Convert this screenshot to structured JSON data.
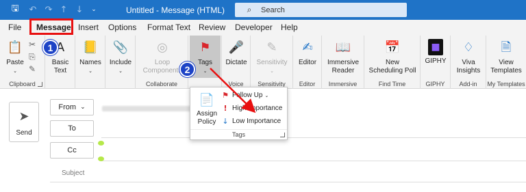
{
  "titlebar": {
    "title": "Untitled  -  Message (HTML)",
    "search_placeholder": "Search",
    "icons": [
      "save-icon",
      "undo-icon",
      "redo-icon",
      "up-arrow-icon",
      "down-arrow-icon",
      "customize-icon"
    ]
  },
  "menu": {
    "tabs": [
      "File",
      "Message",
      "Insert",
      "Options",
      "Format Text",
      "Review",
      "Developer",
      "Help"
    ],
    "active": "Message"
  },
  "ribbon": {
    "paste": "Paste",
    "basic_text": [
      "Basic",
      "Text"
    ],
    "names": "Names",
    "include": "Include",
    "loop": [
      "Loop",
      "Components"
    ],
    "tags": "Tags",
    "dictate": "Dictate",
    "sensitivity": "Sensitivity",
    "editor": "Editor",
    "immersive": [
      "Immersive",
      "Reader"
    ],
    "scheduling": [
      "New",
      "Scheduling Poll"
    ],
    "giphy": "GIPHY",
    "viva": [
      "Viva",
      "Insights"
    ],
    "templates": [
      "View",
      "Templates"
    ],
    "groups": {
      "clipboard": "Clipboard",
      "collaborate": "Collaborate",
      "voice": "Voice",
      "sensitivity": "Sensitivity",
      "editor": "Editor",
      "immersive": "Immersive",
      "findtime": "Find Time",
      "giphy": "GIPHY",
      "addin": "Add-in",
      "mytemplates": "My Templates"
    }
  },
  "tags_dropdown": {
    "assign_policy": [
      "Assign",
      "Policy"
    ],
    "follow_up": "Follow Up",
    "high": "High Importance",
    "low": "Low Importance",
    "group": "Tags"
  },
  "compose": {
    "send": "Send",
    "from": "From",
    "to": "To",
    "cc": "Cc",
    "subject": "Subject"
  },
  "badges": [
    "1",
    "2"
  ],
  "colors": {
    "titlebar": "#1f73c7",
    "highlight": "#e81010",
    "badge": "#1d43c6"
  }
}
